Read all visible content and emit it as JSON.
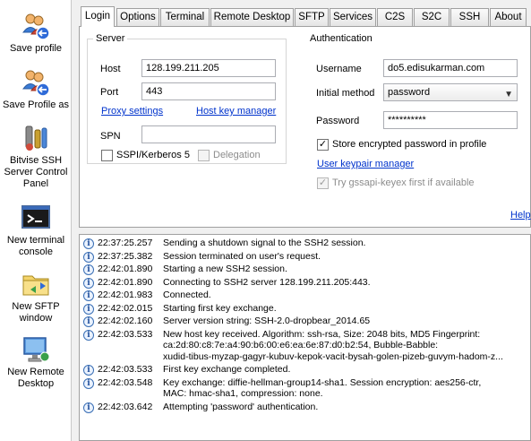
{
  "sidebar": {
    "items": [
      {
        "id": "save-profile",
        "label": "Save profile",
        "icon": "users-arrow-icon"
      },
      {
        "id": "save-profile-as",
        "label": "Save Profile as",
        "icon": "users-arrow-icon"
      },
      {
        "id": "server-control-panel",
        "label": "Bitvise SSH\nServer Control\nPanel",
        "icon": "tools-icon"
      },
      {
        "id": "new-terminal-console",
        "label": "New terminal\nconsole",
        "icon": "terminal-icon"
      },
      {
        "id": "new-sftp-window",
        "label": "New SFTP\nwindow",
        "icon": "folder-icon"
      },
      {
        "id": "new-remote-desktop",
        "label": "New Remote\nDesktop",
        "icon": "remote-desktop-icon"
      }
    ]
  },
  "tabs": [
    "Login",
    "Options",
    "Terminal",
    "Remote Desktop",
    "SFTP",
    "Services",
    "C2S",
    "S2C",
    "SSH",
    "About"
  ],
  "active_tab": "Login",
  "server": {
    "legend": "Server",
    "host_label": "Host",
    "host_value": "128.199.211.205",
    "port_label": "Port",
    "port_value": "443",
    "proxy_settings": "Proxy settings",
    "host_key_manager": "Host key manager",
    "spn_label": "SPN",
    "spn_value": "",
    "sspi_label": "SSPI/Kerberos 5",
    "sspi_checked": false,
    "delegation_label": "Delegation",
    "delegation_checked": false
  },
  "auth": {
    "legend": "Authentication",
    "username_label": "Username",
    "username_value": "do5.edisukarman.com",
    "method_label": "Initial method",
    "method_value": "password",
    "password_label": "Password",
    "password_value": "**********",
    "store_pw_label": "Store encrypted password in profile",
    "store_pw_checked": true,
    "user_keypair_manager": "User keypair manager",
    "gssapi_label": "Try gssapi-keyex first if available",
    "gssapi_checked": true
  },
  "help_link": "Help",
  "log": [
    {
      "time": "22:37:25.257",
      "msg": "Sending a shutdown signal to the SSH2 session."
    },
    {
      "time": "22:37:25.382",
      "msg": "Session terminated on user's request."
    },
    {
      "time": "22:42:01.890",
      "msg": "Starting a new SSH2 session."
    },
    {
      "time": "22:42:01.890",
      "msg": "Connecting to SSH2 server 128.199.211.205:443."
    },
    {
      "time": "22:42:01.983",
      "msg": "Connected."
    },
    {
      "time": "22:42:02.015",
      "msg": "Starting first key exchange."
    },
    {
      "time": "22:42:02.160",
      "msg": "Server version string: SSH-2.0-dropbear_2014.65"
    },
    {
      "time": "22:42:03.533",
      "msg": "New host key received. Algorithm: ssh-rsa, Size: 2048 bits, MD5 Fingerprint:\nca:2d:80:c8:7e:a4:90:b6:00:e6:ea:6e:87:d0:b2:54, Bubble-Babble:\nxudid-tibus-myzap-gagyr-kubuv-kepok-vacit-bysah-golen-pizeb-guvym-hadom-z..."
    },
    {
      "time": "22:42:03.533",
      "msg": "First key exchange completed."
    },
    {
      "time": "22:42:03.548",
      "msg": "Key exchange: diffie-hellman-group14-sha1. Session encryption: aes256-ctr,\nMAC: hmac-sha1, compression: none."
    },
    {
      "time": "22:42:03.642",
      "msg": "Attempting 'password' authentication."
    }
  ]
}
